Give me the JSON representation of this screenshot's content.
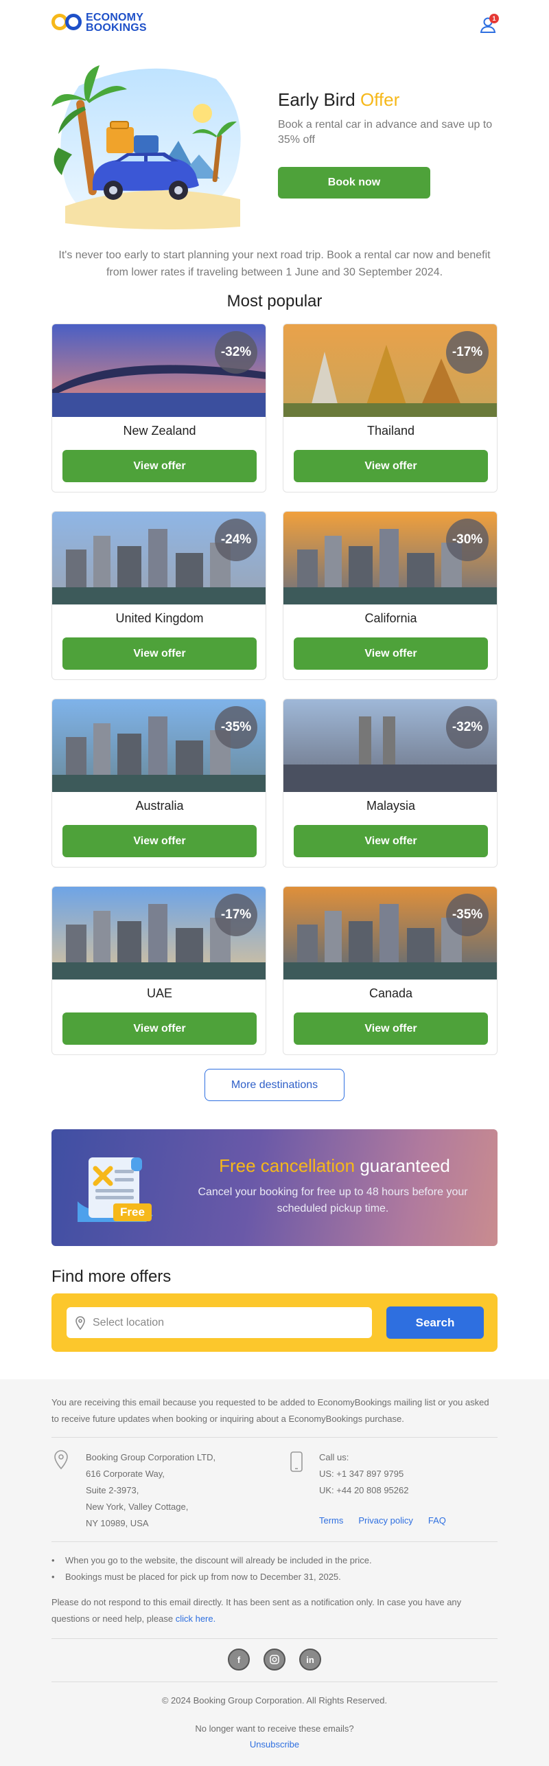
{
  "brand": {
    "line1": "ECONOMY",
    "line2": "BOOKINGS",
    "notification_count": "1"
  },
  "hero": {
    "title_main": "Early Bird",
    "title_accent": "Offer",
    "subtitle": "Book a rental car in advance and save up to 35% off",
    "button": "Book now"
  },
  "intro": "It's never too early to start planning your next road trip. Book a rental car now and benefit from lower rates if traveling between 1 June and 30 September 2024.",
  "popular": {
    "title": "Most popular",
    "button_label": "View offer",
    "items": [
      {
        "name": "New Zealand",
        "discount": "-32%"
      },
      {
        "name": "Thailand",
        "discount": "-17%"
      },
      {
        "name": "United Kingdom",
        "discount": "-24%"
      },
      {
        "name": "California",
        "discount": "-30%"
      },
      {
        "name": "Australia",
        "discount": "-35%"
      },
      {
        "name": "Malaysia",
        "discount": "-32%"
      },
      {
        "name": "UAE",
        "discount": "-17%"
      },
      {
        "name": "Canada",
        "discount": "-35%"
      }
    ],
    "more_button": "More destinations"
  },
  "cancellation": {
    "title_accent": "Free cancellation",
    "title_main": "guaranteed",
    "subtitle": "Cancel your booking for free up to 48 hours before your scheduled pickup time.",
    "tag": "Free"
  },
  "find": {
    "title": "Find more offers",
    "placeholder": "Select location",
    "button": "Search"
  },
  "footer": {
    "note": "You are receiving this email because you requested to be added to EconomyBookings mailing list or you asked to receive future updates when booking or inquiring about a EconomyBookings purchase.",
    "address": [
      "Booking Group Corporation LTD,",
      "616 Corporate Way,",
      "Suite 2-3973,",
      "New York, Valley Cottage,",
      "NY 10989, USA"
    ],
    "call_label": "Call us:",
    "phone_us": "US: +1 347 897 9795",
    "phone_uk": "UK: +44 20 808 95262",
    "links": [
      "Terms",
      "Privacy policy",
      "FAQ"
    ],
    "bullets": [
      "When you go to the website, the discount will already be included in the price.",
      "Bookings must be placed for pick up from now to December 31, 2025."
    ],
    "noreply": "Please do not respond to this email directly. It has been sent as a notification only. In case you have any questions or need help, please",
    "noreply_link": "click here.",
    "socials": [
      "facebook-icon",
      "instagram-icon",
      "linkedin-icon"
    ],
    "copyright": "© 2024 Booking Group Corporation. All Rights Reserved.",
    "unsub_question": "No longer want to receive these emails?",
    "unsub_link": "Unsubscribe"
  },
  "colors": {
    "accent": "#f6b81a",
    "brand_blue": "#1e50c8",
    "green": "#4ea23a",
    "search_bg": "#fcc72c"
  }
}
